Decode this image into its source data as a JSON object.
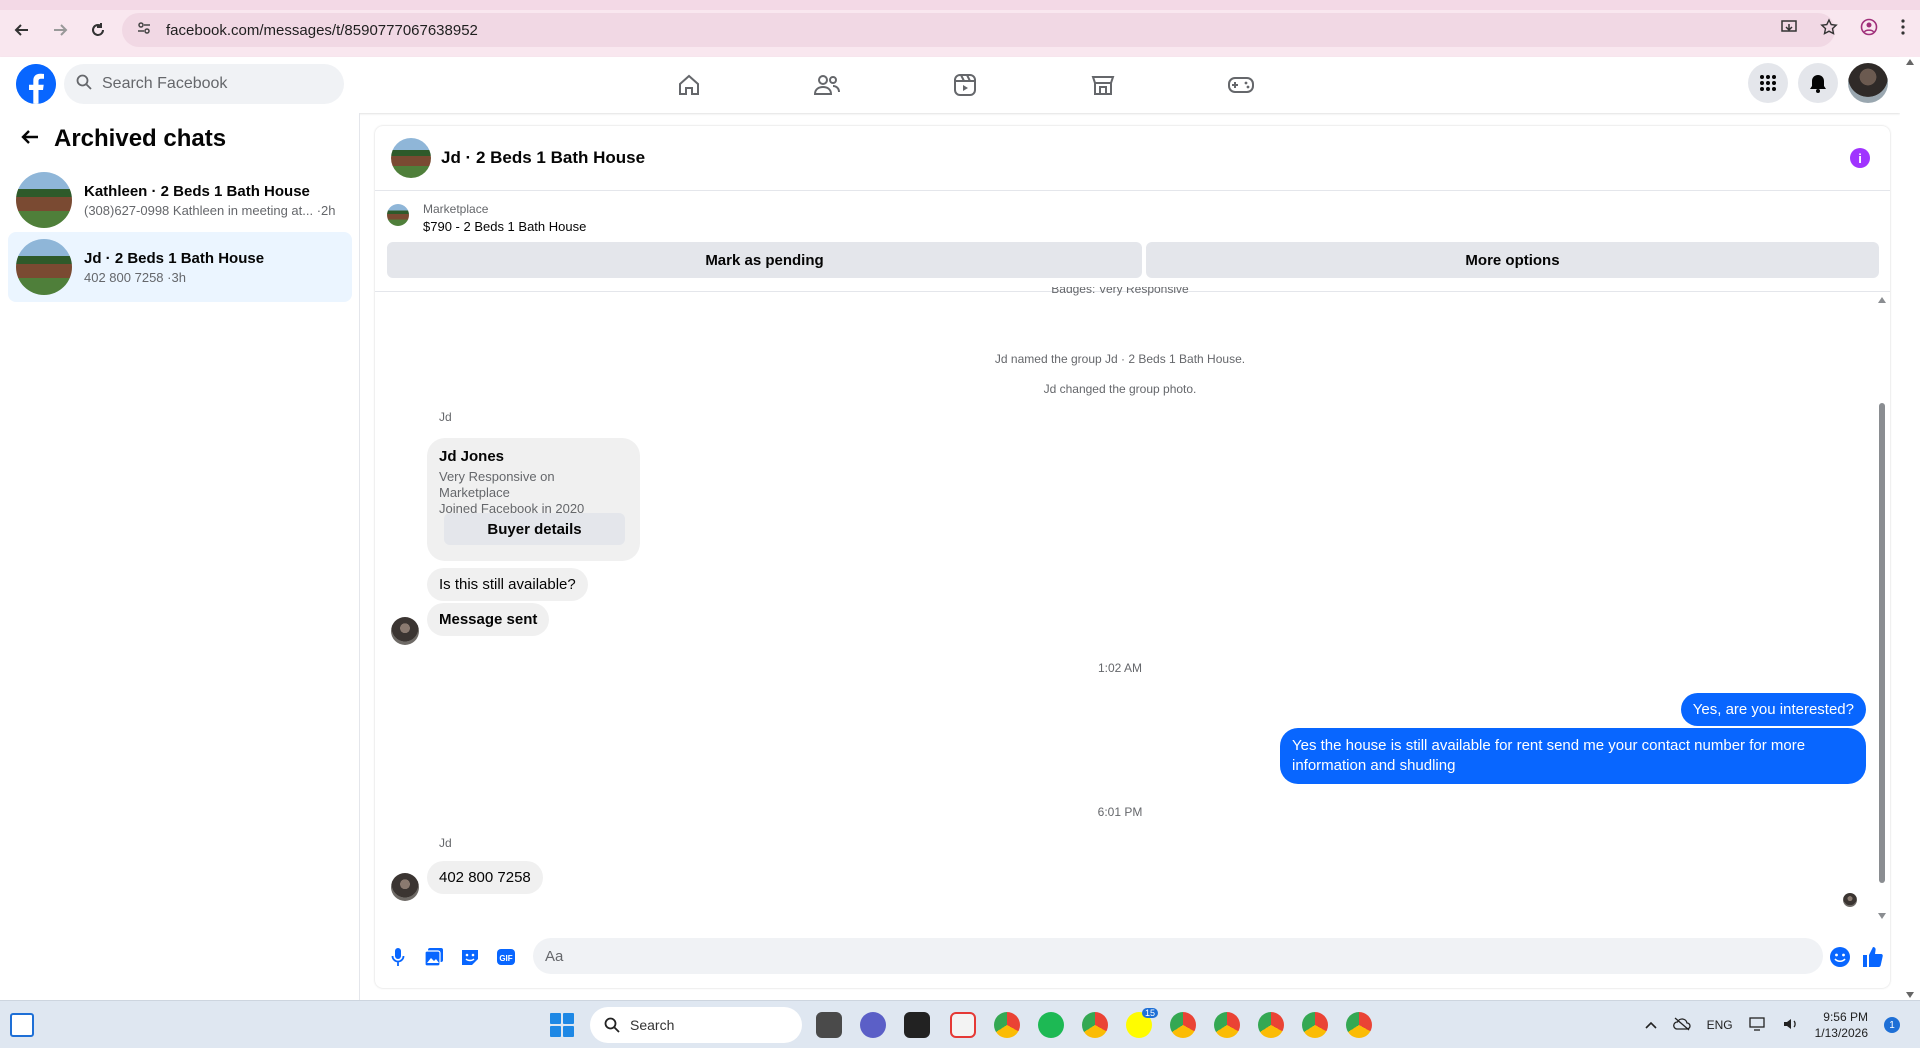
{
  "browser": {
    "url": "facebook.com/messages/t/8590777067638952"
  },
  "fb": {
    "search_placeholder": "Search Facebook"
  },
  "sidebar": {
    "title": "Archived chats",
    "chats": [
      {
        "name": "Kathleen · 2 Beds 1 Bath House",
        "preview": "(308)627-0998 Kathleen in meeting at... ·2h",
        "active": false
      },
      {
        "name": "Jd · 2 Beds 1 Bath House",
        "preview": "402 800 7258 ·3h",
        "active": true
      }
    ]
  },
  "chat": {
    "title": "Jd · 2 Beds 1 Bath House",
    "marketplace": {
      "label": "Marketplace",
      "listing": "$790 - 2 Beds 1 Bath House",
      "pending_button": "Mark as pending",
      "more_button": "More options"
    },
    "system": {
      "partial_top": "Badges: Very Responsive",
      "named": "Jd named the group Jd · 2 Beds 1 Bath House.",
      "photo": "Jd changed the group photo.",
      "time1": "1:02 AM",
      "time2": "6:01 PM"
    },
    "sender": "Jd",
    "buyer_card": {
      "name": "Jd Jones",
      "line1": "Very Responsive on Marketplace",
      "line2": "Joined Facebook in 2020",
      "button": "Buyer details"
    },
    "messages_in_1": [
      "Is this still available?",
      "Message sent"
    ],
    "messages_out": [
      "Yes, are you interested?",
      "Yes the house is still available for rent send me your contact number for more information and shudling"
    ],
    "messages_in_2": [
      "402 800 7258"
    ],
    "composer_placeholder": "Aa",
    "icons": [
      "microphone-icon",
      "photo-icon",
      "sticker-icon",
      "gif-icon",
      "emoji-icon",
      "like-icon"
    ]
  },
  "taskbar": {
    "search": "Search",
    "lang": "ENG",
    "time": "9:56 PM",
    "date": "1/13/2026",
    "notif_count": "1",
    "snap_badge": "15"
  },
  "colors": {
    "fb_blue": "#0866ff",
    "bubble_grey": "#f0f0f0",
    "info_purple": "#a033ff"
  }
}
